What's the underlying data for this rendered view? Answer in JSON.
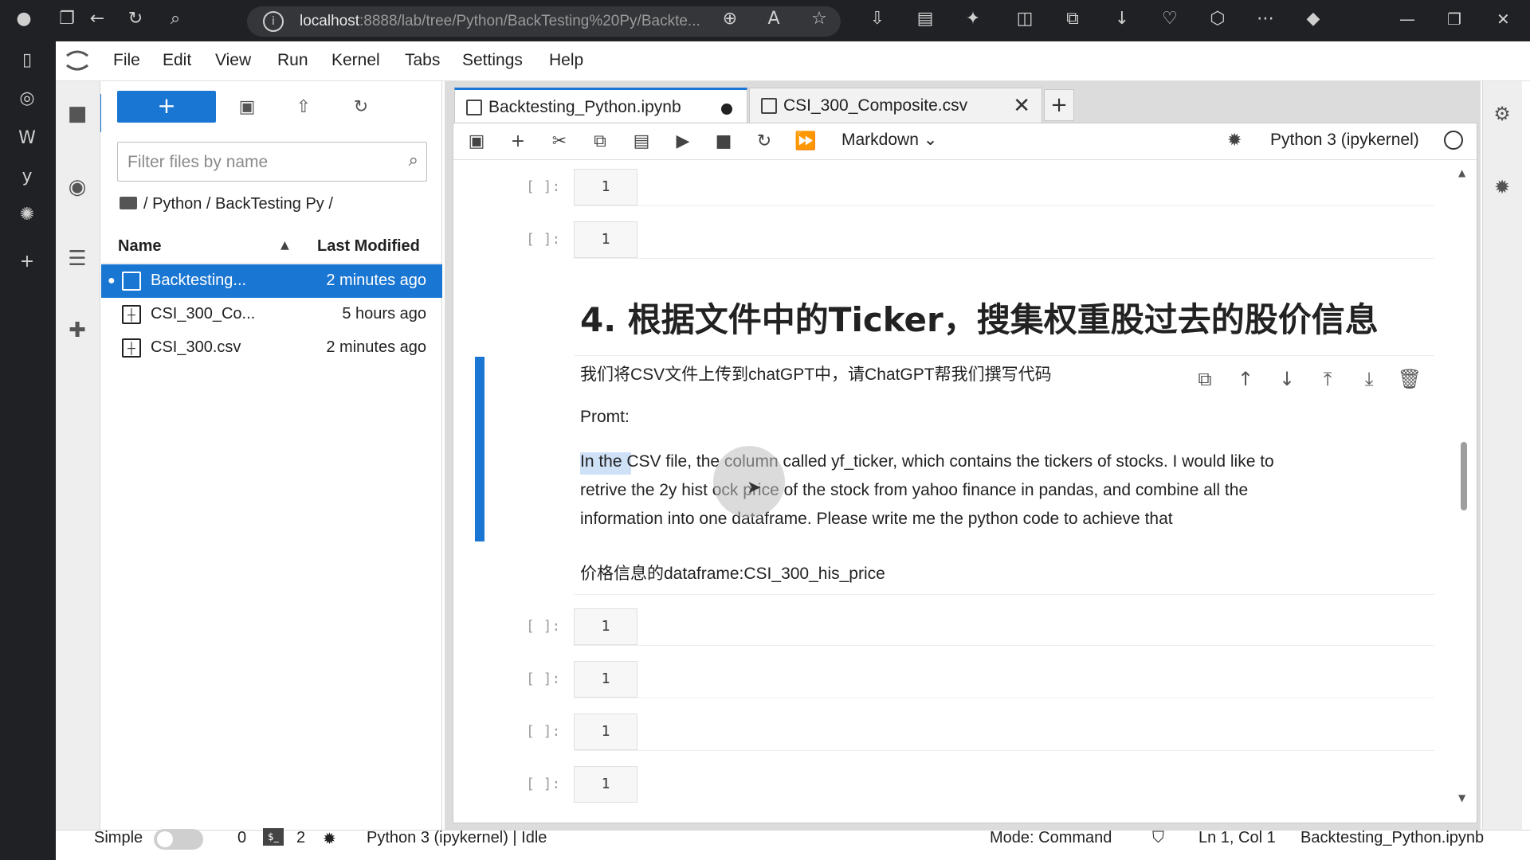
{
  "browser": {
    "url_host": "localhost",
    "url_rest": ":8888/lab/tree/Python/BackTesting%20Py/Backte..."
  },
  "menubar": {
    "items": [
      "File",
      "Edit",
      "View",
      "Run",
      "Kernel",
      "Tabs",
      "Settings",
      "Help"
    ]
  },
  "filebrowser": {
    "new_label": "+",
    "filter_placeholder": "Filter files by name",
    "breadcrumb": "/ Python / BackTesting Py /",
    "col_name": "Name",
    "col_modified": "Last Modified",
    "files": [
      {
        "name": "Backtesting...",
        "modified": "2 minutes ago",
        "selected": true
      },
      {
        "name": "CSI_300_Co...",
        "modified": "5 hours ago",
        "selected": false
      },
      {
        "name": "CSI_300.csv",
        "modified": "2 minutes ago",
        "selected": false
      }
    ]
  },
  "tabs": [
    {
      "label": "Backtesting_Python.ipynb",
      "active": true
    },
    {
      "label": "CSI_300_Composite.csv",
      "active": false
    }
  ],
  "notebook": {
    "cell_type": "Markdown",
    "kernel": "Python 3 (ipykernel)",
    "prompt": "[ ]:",
    "code_line": "1",
    "heading": "4. 根据文件中的Ticker，搜集权重股过去的股价信息",
    "md_line1": "我们将CSV文件上传到chatGPT中，请ChatGPT帮我们撰写代码",
    "md_line2": "Promt:",
    "md_p1": "In the CSV file, the        column called yf_ticker, which contains the tickers of stocks. I would like to",
    "md_p2": "retrive the 2y hist        ock price of the stock from yahoo finance in pandas, and combine all the",
    "md_p3": "information into one dataframe. Please write me the python code to achieve that",
    "md_line3": "价格信息的dataframe:CSI_300_his_price"
  },
  "statusbar": {
    "simple": "Simple",
    "zero": "0",
    "two": "2",
    "kernel_status": "Python 3 (ipykernel) | Idle",
    "mode": "Mode: Command",
    "position": "Ln 1, Col 1",
    "filename": "Backtesting_Python.ipynb"
  }
}
